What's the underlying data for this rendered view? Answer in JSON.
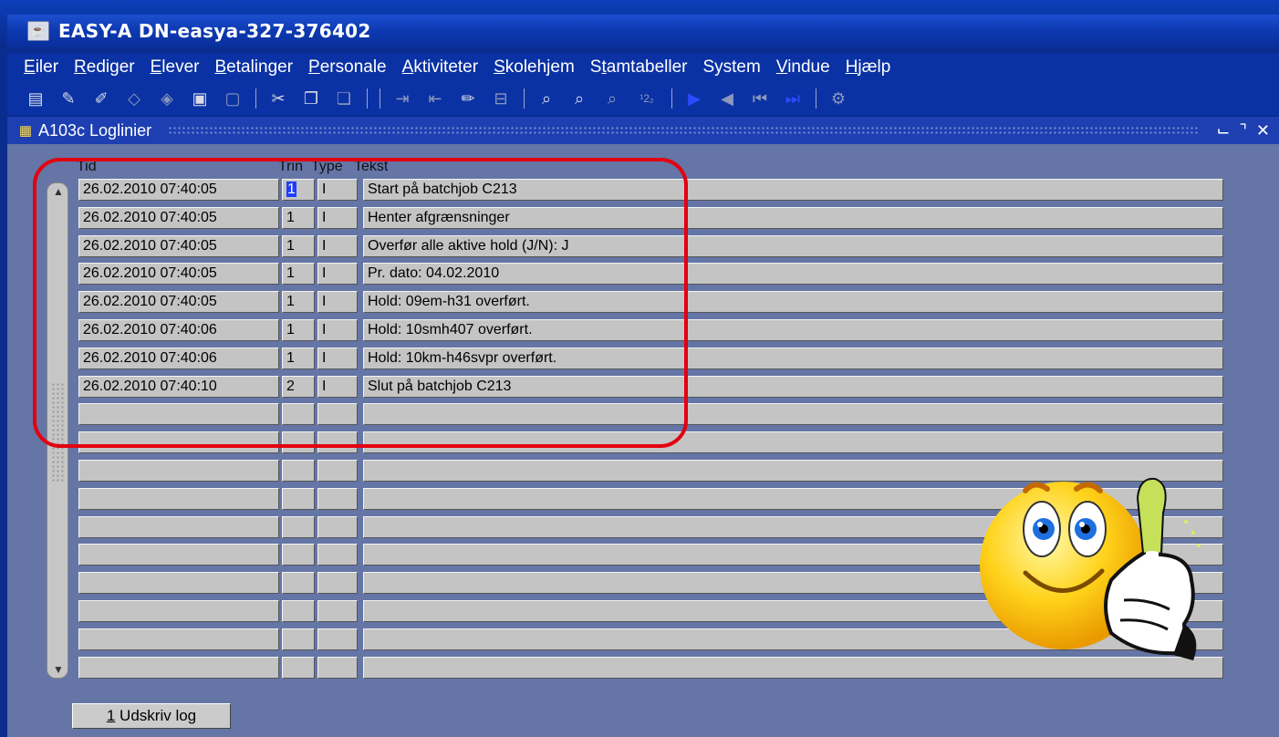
{
  "window": {
    "title": "EASY-A DN-easya-327-376402"
  },
  "menu": [
    {
      "accel": "E",
      "rest": "iler"
    },
    {
      "accel": "R",
      "rest": "ediger"
    },
    {
      "accel": "E",
      "rest": "lever"
    },
    {
      "accel": "B",
      "rest": "etalinger"
    },
    {
      "accel": "P",
      "rest": "ersonale"
    },
    {
      "accel": "A",
      "rest": "ktiviteter"
    },
    {
      "accel": "S",
      "rest": "kolehjem"
    },
    {
      "pre": "S",
      "accel": "t",
      "rest": "amtabeller"
    },
    {
      "accel": "",
      "rest": "System"
    },
    {
      "accel": "V",
      "rest": "indue"
    },
    {
      "accel": "H",
      "rest": "jælp"
    }
  ],
  "toolbar": {
    "superscript_label": "¹2₂"
  },
  "subwindow": {
    "title": "A103c Loglinier"
  },
  "table": {
    "headers": {
      "tid": "Tid",
      "trin": "Trin",
      "type": "Type",
      "tekst": "Tekst"
    },
    "rows": [
      {
        "tid": "26.02.2010 07:40:05",
        "trin": "1",
        "type": "I",
        "tekst": "Start på batchjob C213"
      },
      {
        "tid": "26.02.2010 07:40:05",
        "trin": "1",
        "type": "I",
        "tekst": "Henter afgrænsninger"
      },
      {
        "tid": "26.02.2010 07:40:05",
        "trin": "1",
        "type": "I",
        "tekst": "Overfør alle aktive hold (J/N):  J"
      },
      {
        "tid": "26.02.2010 07:40:05",
        "trin": "1",
        "type": "I",
        "tekst": "Pr. dato:  04.02.2010"
      },
      {
        "tid": "26.02.2010 07:40:05",
        "trin": "1",
        "type": "I",
        "tekst": "Hold: 09em-h31 overført."
      },
      {
        "tid": "26.02.2010 07:40:06",
        "trin": "1",
        "type": "I",
        "tekst": "Hold: 10smh407 overført."
      },
      {
        "tid": "26.02.2010 07:40:06",
        "trin": "1",
        "type": "I",
        "tekst": "Hold: 10km-h46svpr overført."
      },
      {
        "tid": "26.02.2010 07:40:10",
        "trin": "2",
        "type": "I",
        "tekst": "Slut på batchjob C213"
      },
      {
        "tid": "",
        "trin": "",
        "type": "",
        "tekst": ""
      },
      {
        "tid": "",
        "trin": "",
        "type": "",
        "tekst": ""
      },
      {
        "tid": "",
        "trin": "",
        "type": "",
        "tekst": ""
      },
      {
        "tid": "",
        "trin": "",
        "type": "",
        "tekst": ""
      },
      {
        "tid": "",
        "trin": "",
        "type": "",
        "tekst": ""
      },
      {
        "tid": "",
        "trin": "",
        "type": "",
        "tekst": ""
      },
      {
        "tid": "",
        "trin": "",
        "type": "",
        "tekst": ""
      },
      {
        "tid": "",
        "trin": "",
        "type": "",
        "tekst": ""
      },
      {
        "tid": "",
        "trin": "",
        "type": "",
        "tekst": ""
      },
      {
        "tid": "",
        "trin": "",
        "type": "",
        "tekst": ""
      }
    ]
  },
  "buttons": {
    "print_accel": "1",
    "print_rest": " Udskriv log"
  },
  "colors": {
    "highlight_box": "#e3000f",
    "selection": "#1e3cff"
  }
}
